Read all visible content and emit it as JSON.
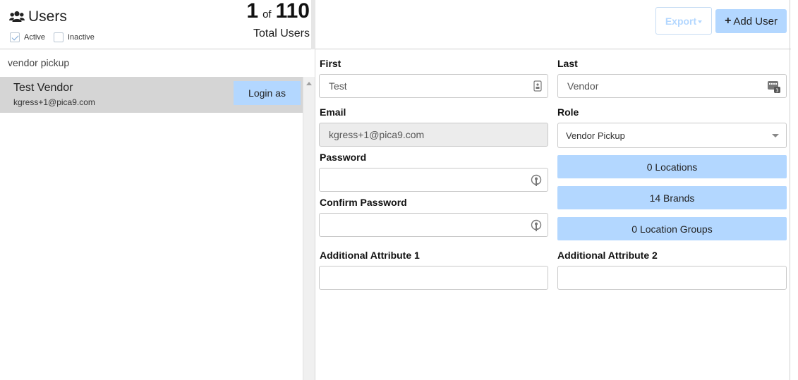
{
  "header": {
    "title": "Users",
    "filters": [
      {
        "label": "Active",
        "checked": true
      },
      {
        "label": "Inactive",
        "checked": false
      }
    ],
    "count_current": "1",
    "count_of": "of",
    "count_total": "110",
    "total_label": "Total Users"
  },
  "search": {
    "value": "vendor pickup"
  },
  "list": {
    "items": [
      {
        "name": "Test Vendor",
        "email": "kgress+1@pica9.com",
        "action_label": "Login as"
      }
    ]
  },
  "toolbar": {
    "export_label": "Export",
    "add_user_label": "Add User"
  },
  "form": {
    "first_label": "First",
    "first_value": "Test",
    "last_label": "Last",
    "last_value": "Vendor",
    "email_label": "Email",
    "email_value": "kgress+1@pica9.com",
    "role_label": "Role",
    "role_value": "Vendor Pickup",
    "password_label": "Password",
    "password_value": "",
    "confirm_password_label": "Confirm Password",
    "confirm_password_value": "",
    "locations_label": "0 Locations",
    "brands_label": "14 Brands",
    "location_groups_label": "0 Location Groups",
    "attr1_label": "Additional Attribute 1",
    "attr1_value": "",
    "attr2_label": "Additional Attribute 2",
    "attr2_value": ""
  },
  "colors": {
    "accent": "#b3d7ff",
    "selected_row": "#d5d5d5",
    "readonly_field": "#ececec"
  }
}
